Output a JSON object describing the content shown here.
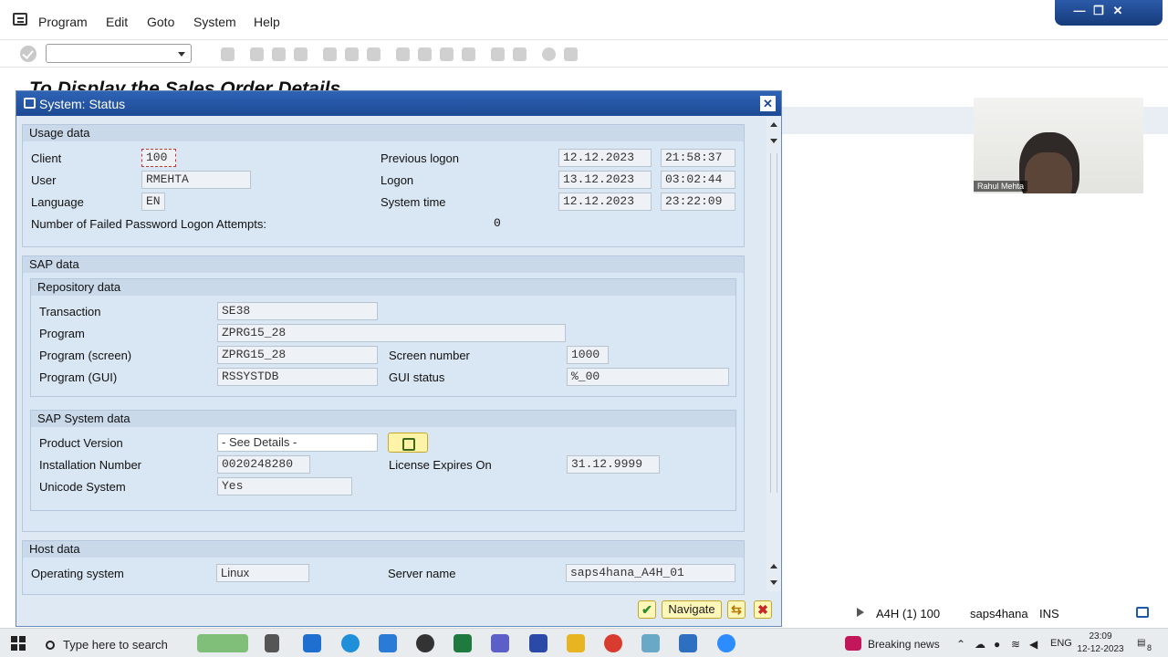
{
  "menu": {
    "items": [
      "Program",
      "Edit",
      "Goto",
      "System",
      "Help"
    ]
  },
  "window_controls": {
    "minimize": "—",
    "restore": "❐",
    "close": "✕"
  },
  "background": {
    "title": "To Display the Sales Order Details"
  },
  "video": {
    "participant": "Rahul Mehta"
  },
  "dialog": {
    "title": "System: Status",
    "usage": {
      "header": "Usage data",
      "client_label": "Client",
      "client": "100",
      "user_label": "User",
      "user": "RMEHTA",
      "language_label": "Language",
      "language": "EN",
      "failed_label": "Number of Failed Password Logon Attempts:",
      "failed": "0",
      "prev_logon_label": "Previous logon",
      "prev_logon_date": "12.12.2023",
      "prev_logon_time": "21:58:37",
      "logon_label": "Logon",
      "logon_date": "13.12.2023",
      "logon_time": "03:02:44",
      "system_time_label": "System time",
      "system_date": "12.12.2023",
      "system_time": "23:22:09"
    },
    "sap": {
      "header": "SAP data",
      "repo": {
        "header": "Repository data",
        "transaction_label": "Transaction",
        "transaction": "SE38",
        "program_label": "Program",
        "program": "ZPRG15_28",
        "program_screen_label": "Program (screen)",
        "program_screen": "ZPRG15_28",
        "program_gui_label": "Program (GUI)",
        "program_gui": "RSSYSTDB",
        "screen_number_label": "Screen number",
        "screen_number": "1000",
        "gui_status_label": "GUI status",
        "gui_status": "%_00"
      },
      "system": {
        "header": "SAP System data",
        "product_version_label": "Product Version",
        "product_version": "- See Details -",
        "installation_label": "Installation Number",
        "installation": "0020248280",
        "unicode_label": "Unicode System",
        "unicode": "Yes",
        "license_label": "License Expires On",
        "license": "31.12.9999"
      }
    },
    "host": {
      "header": "Host data",
      "os_label": "Operating system",
      "os": "Linux",
      "server_label": "Server name",
      "server": "saps4hana_A4H_01"
    },
    "buttons": {
      "navigate": "Navigate"
    }
  },
  "statusbar": {
    "system": "A4H (1) 100",
    "server": "saps4hana",
    "mode": "INS"
  },
  "taskbar": {
    "search": "Type here to search",
    "news": "Breaking news",
    "lang": "ENG",
    "time": "23:09",
    "date": "12-12-2023",
    "notifications": "8"
  },
  "colors": {
    "title_bar": "#1d4a94",
    "dialog_bg": "#dfe9f4",
    "group_bg": "#d9e6f3",
    "button_yellow": "#fff7b8"
  }
}
